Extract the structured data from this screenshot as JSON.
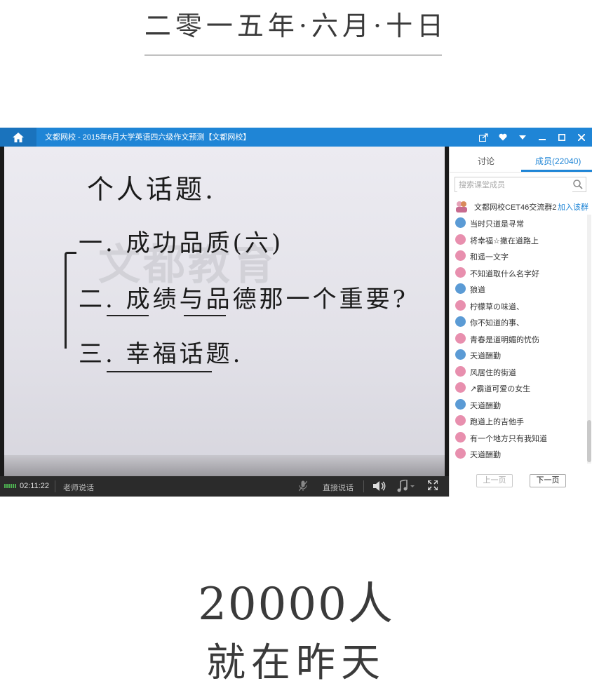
{
  "header": {
    "date": "二零一五年·六月·十日"
  },
  "app": {
    "title": "文都网校 - 2015年6月大学英语四六级作文预测【文都网校】",
    "board": {
      "watermark": "文都教育",
      "line1": "个人话题.",
      "line2": "一. 成功品质(六)",
      "line3": "二. 成绩与品德那一个重要?",
      "line4": "三. 幸福话题."
    },
    "bottombar": {
      "time": "02:11:22",
      "speaker": "老师说话",
      "direct_talk": "直接说话"
    },
    "side": {
      "tab_discuss": "讨论",
      "tab_members": "成员(22040)",
      "search_placeholder": "搜索课堂成员",
      "group_name": "文都网校CET46交流群2",
      "join_label": "加入该群",
      "members": [
        {
          "name": "当时只道是寻常",
          "color": "#5b9bd5"
        },
        {
          "name": "将幸福☆撒在道路上",
          "color": "#e88fae"
        },
        {
          "name": "和遥一文字",
          "color": "#e88fae"
        },
        {
          "name": "不知道取什么名字好",
          "color": "#e88fae"
        },
        {
          "name": "狼道",
          "color": "#5b9bd5"
        },
        {
          "name": "柠檬草の味道、",
          "color": "#e88fae"
        },
        {
          "name": "你不知道的事、",
          "color": "#5b9bd5"
        },
        {
          "name": "青春是道明媚的忧伤",
          "color": "#e88fae"
        },
        {
          "name": "天道酬勤",
          "color": "#5b9bd5"
        },
        {
          "name": "风居住的街道",
          "color": "#e88fae"
        },
        {
          "name": "↗霸道可爱の女生",
          "color": "#e88fae"
        },
        {
          "name": "天道酬勤",
          "color": "#5b9bd5"
        },
        {
          "name": "跑道上的吉他手",
          "color": "#e88fae"
        },
        {
          "name": "有一个地方只有我知道",
          "color": "#e88fae"
        },
        {
          "name": "天道酬勤",
          "color": "#e88fae"
        }
      ],
      "prev_page": "上一页",
      "next_page": "下一页"
    }
  },
  "footer": {
    "count": "20000人",
    "subtitle": "就在昨天"
  },
  "colors": {
    "accent": "#1f85d6"
  }
}
